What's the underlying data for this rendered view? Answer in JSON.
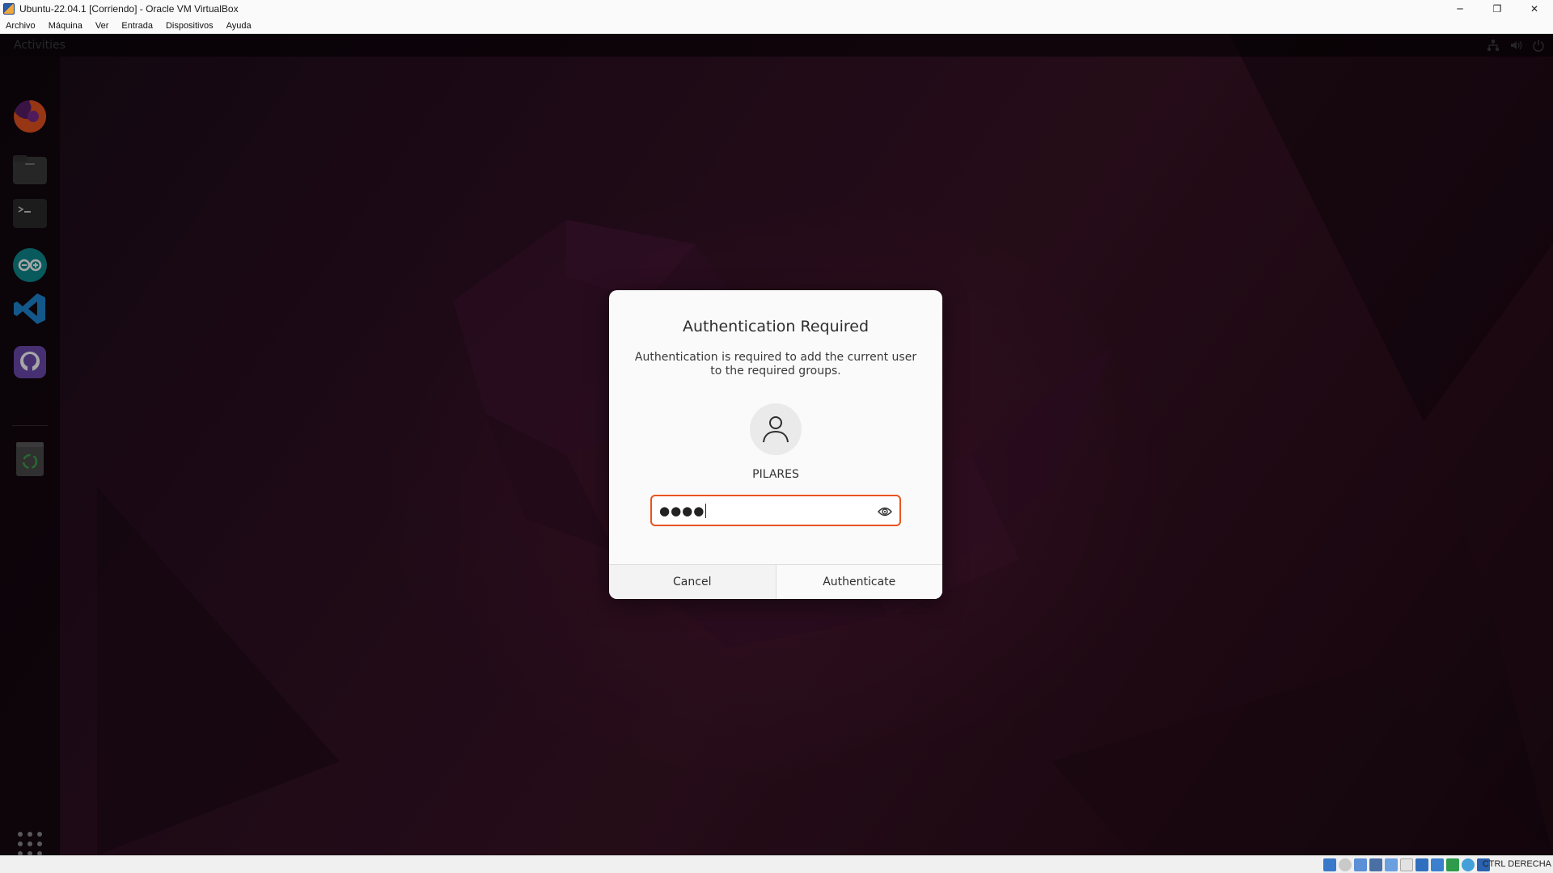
{
  "window": {
    "title": "Ubuntu-22.04.1 [Corriendo] - Oracle VM VirtualBox",
    "controls": {
      "minimize": "─",
      "restore": "❐",
      "close": "✕"
    }
  },
  "menubar": {
    "items": [
      "Archivo",
      "Máquina",
      "Ver",
      "Entrada",
      "Dispositivos",
      "Ayuda"
    ]
  },
  "guest": {
    "topbar": {
      "activities": "Activities"
    },
    "tray_icons": [
      "network-icon",
      "volume-icon",
      "power-icon"
    ],
    "dock": {
      "items": [
        "firefox-icon",
        "files-icon",
        "terminal-icon",
        "arduino-icon",
        "vscode-icon",
        "github-desktop-icon",
        "trash-icon"
      ],
      "show_apps_icon": "grid-icon"
    }
  },
  "dialog": {
    "title": "Authentication Required",
    "message": "Authentication is required to add the current user to the required groups.",
    "username": "PILARES",
    "password_masked": "●●●●",
    "cancel_label": "Cancel",
    "authenticate_label": "Authenticate",
    "accent_color": "#e95420"
  },
  "statusbar": {
    "host_key": "CTRL DERECHA"
  }
}
